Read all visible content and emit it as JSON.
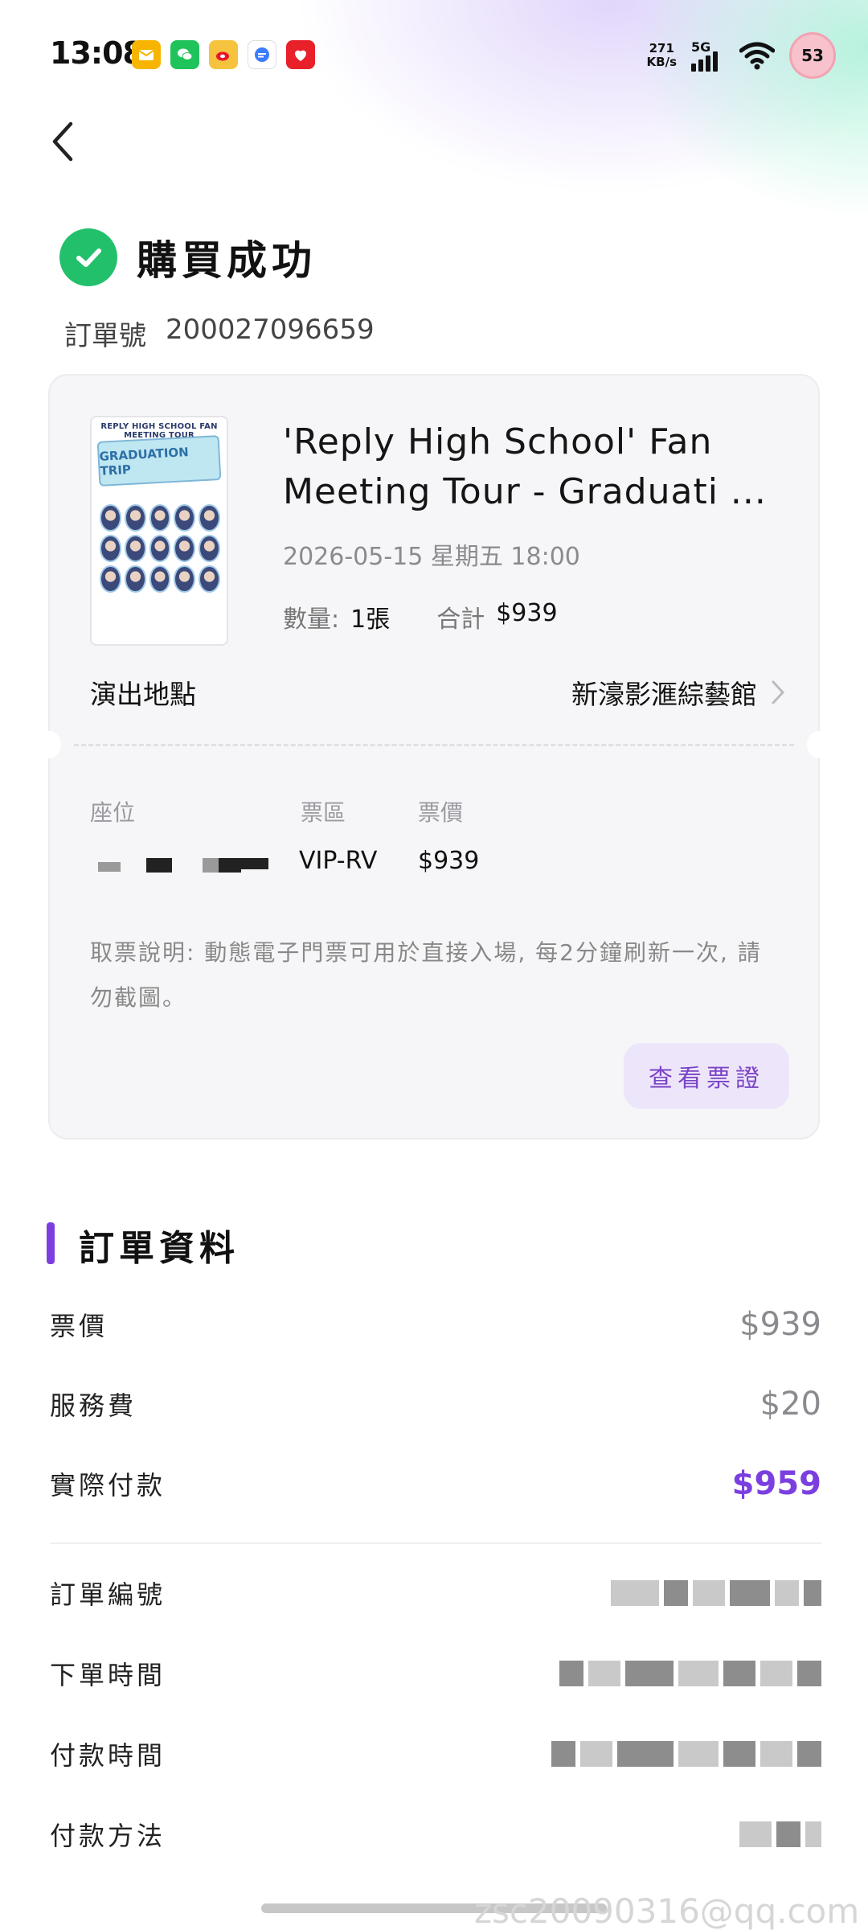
{
  "status_bar": {
    "time": "13:08",
    "net_speed_value": "271",
    "net_speed_unit": "KB/s",
    "network": "5G",
    "battery": "53",
    "notification_icons": [
      "mail-icon",
      "wechat-icon",
      "weibo-icon",
      "message-icon",
      "gift-icon"
    ]
  },
  "header": {
    "success_title": "購買成功",
    "order_label": "訂單號",
    "order_number": "200027096659"
  },
  "ticket": {
    "poster_caption": "REPLY HIGH SCHOOL FAN MEETING TOUR",
    "poster_logo": "GRADUATION TRIP",
    "event_title": "'Reply High School' Fan Meeting Tour - Graduati ...",
    "datetime": "2026-05-15 星期五 18:00",
    "qty_label": "數量:",
    "qty_value": "1張",
    "total_label": "合計",
    "total_value": "$939",
    "venue_label": "演出地點",
    "venue_name": "新濠影滙綜藝館",
    "seat_header": "座位",
    "zone_header": "票區",
    "price_header": "票價",
    "zone_value": "VIP-RV",
    "price_value": "$939",
    "pickup_note": "取票說明: 動態電子門票可用於直接入場, 每2分鐘刷新一次, 請勿截圖。",
    "view_ticket_button": "查看票證"
  },
  "order_info": {
    "section_title": "訂單資料",
    "rows": [
      {
        "label": "票價",
        "value": "$939"
      },
      {
        "label": "服務費",
        "value": "$20"
      },
      {
        "label": "實際付款",
        "value": "$959"
      }
    ],
    "detail_labels": {
      "order_id": "訂單編號",
      "order_time": "下單時間",
      "pay_time": "付款時間",
      "pay_method": "付款方法"
    }
  },
  "watermark": "zsc20090316@qq.com",
  "colors": {
    "accent": "#7b3fe0",
    "success": "#22c06b",
    "button_bg": "#ede6fb"
  }
}
